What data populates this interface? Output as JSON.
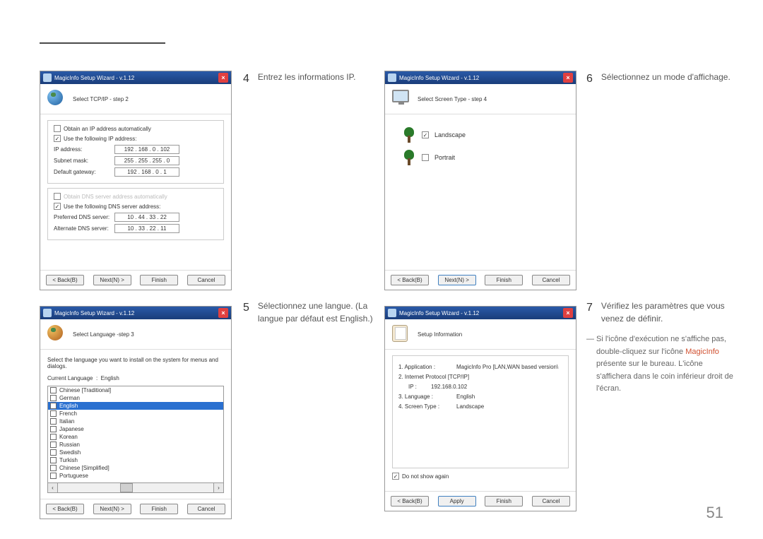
{
  "page_number": "51",
  "window_title": "MagicInfo Setup Wizard - v.1.12",
  "buttons": {
    "back": "< Back(B)",
    "next": "Next(N) >",
    "finish": "Finish",
    "cancel": "Cancel",
    "apply": "Apply"
  },
  "step4": {
    "num": "4",
    "text": "Entrez les informations IP.",
    "header": "Select TCP/IP - step 2",
    "opt_auto": "Obtain an IP address automatically",
    "opt_man": "Use the following IP address:",
    "ip_lbl": "IP address:",
    "ip": "192 . 168 .  0  . 102",
    "sn_lbl": "Subnet mask:",
    "sn": "255 . 255 . 255 .  0",
    "gw_lbl": "Default gateway:",
    "gw": "192 . 168 .  0  .   1",
    "dns_auto": "Obtain DNS server address automatically",
    "dns_man": "Use the following DNS server address:",
    "pd_lbl": "Preferred DNS server:",
    "pd": "10 . 44 . 33 . 22",
    "ad_lbl": "Alternate DNS server:",
    "ad": "10 . 33 . 22 . 11"
  },
  "step5": {
    "num": "5",
    "text": "Sélectionnez une langue. (La langue par défaut est English.)",
    "header": "Select Language -step 3",
    "desc": "Select the language you want to install on the system for menus and dialogs.",
    "cur_lbl": "Current Language",
    "cur_val": "English",
    "langs": [
      "Chinese [Traditional]",
      "German",
      "English",
      "French",
      "Italian",
      "Japanese",
      "Korean",
      "Russian",
      "Swedish",
      "Turkish",
      "Chinese [Simplified]",
      "Portuguese"
    ]
  },
  "step6": {
    "num": "6",
    "text": "Sélectionnez un mode d'affichage.",
    "header": "Select Screen Type - step 4",
    "landscape": "Landscape",
    "portrait": "Portrait"
  },
  "step7": {
    "num": "7",
    "text": "Vérifiez les paramètres que vous venez de définir.",
    "header": "Setup Information",
    "r1l": "1. Application :",
    "r1v": "MagicInfo Pro [LAN,WAN based version\\",
    "r2l": "2. Internet Protocol [TCP/IP]",
    "ipl": "IP :",
    "ipv": "192.168.0.102",
    "r3l": "3. Language :",
    "r3v": "English",
    "r4l": "4. Screen Type :",
    "r4v": "Landscape",
    "dns": "Do not show again"
  },
  "note_pre": "Si l'icône d'exécution ne s'affiche pas, double-cliquez sur l'icône ",
  "note_mi": "MagicInfo",
  "note_post": " présente sur le bureau. L'icône s'affichera dans le coin inférieur droit de l'écran."
}
